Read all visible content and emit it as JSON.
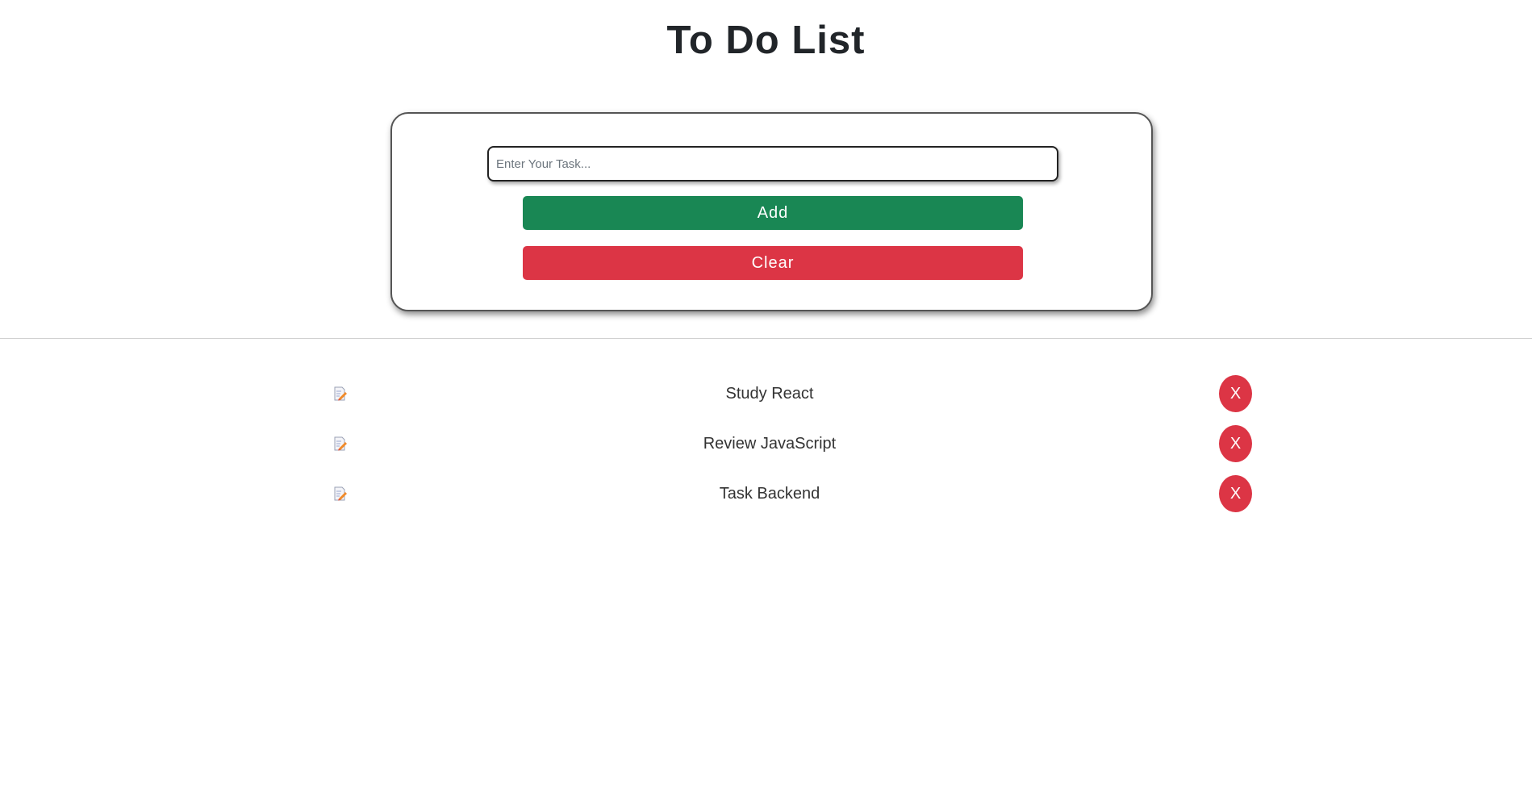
{
  "header": {
    "title": "To Do List"
  },
  "form": {
    "input_placeholder": "Enter Your Task...",
    "input_value": "",
    "add_label": "Add",
    "clear_label": "Clear"
  },
  "tasks": [
    {
      "label": "Study React",
      "remove_label": "X",
      "icon": "edit-icon"
    },
    {
      "label": "Review JavaScript",
      "remove_label": "X",
      "icon": "edit-icon"
    },
    {
      "label": "Task Backend",
      "remove_label": "X",
      "icon": "edit-icon"
    }
  ],
  "colors": {
    "add": "#198754",
    "clear": "#dc3545",
    "remove": "#dc3545"
  }
}
